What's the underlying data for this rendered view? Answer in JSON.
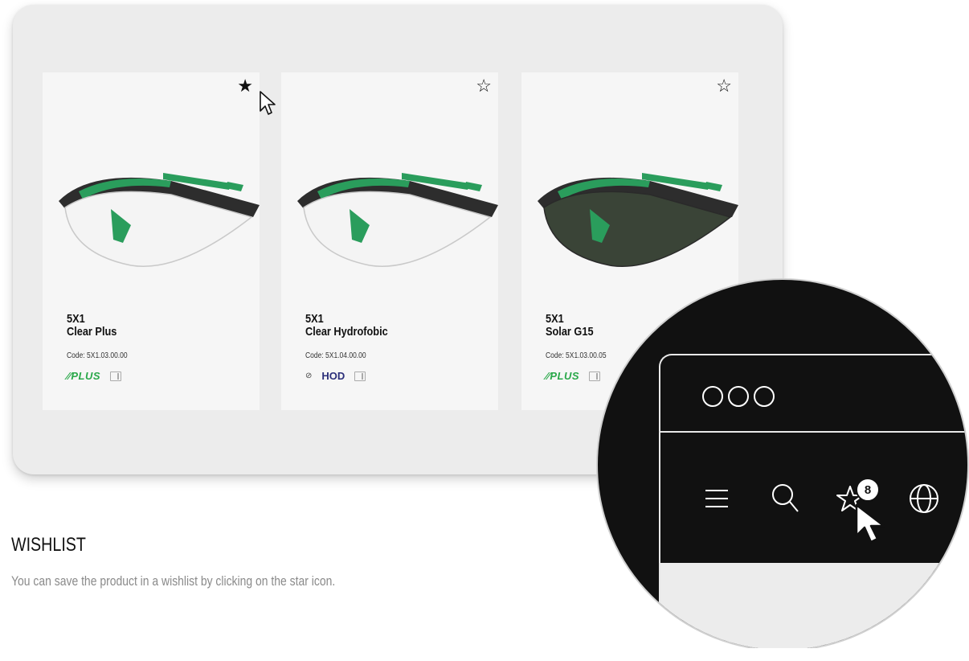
{
  "products": [
    {
      "model": "5X1",
      "name": "Clear Plus",
      "code": "Code: 5X1.03.00.00",
      "badges": [
        "PLUS"
      ],
      "star_filled": true,
      "lens_color": "#f4f4f4"
    },
    {
      "model": "5X1",
      "name": "Clear Hydrofobic",
      "code": "Code: 5X1.04.00.00",
      "badges": [
        "HOD"
      ],
      "star_filled": false,
      "lens_color": "#f4f4f4"
    },
    {
      "model": "5X1",
      "name": "Solar G15",
      "code": "Code: 5X1.03.00.05",
      "badges": [
        "PLUS"
      ],
      "star_filled": false,
      "lens_color": "#3a4437"
    }
  ],
  "icons": {
    "star_filled": "★",
    "star_outline": "☆"
  },
  "section": {
    "heading": "WISHLIST",
    "description": "You can save the product in a wishlist by clicking on the star icon."
  },
  "zoom": {
    "wishlist_count": "8"
  },
  "colors": {
    "frame_green": "#2a9d5c",
    "frame_dark": "#2d2d2d",
    "badge_green": "#2aa84a",
    "badge_navy": "#2b2f7a"
  }
}
